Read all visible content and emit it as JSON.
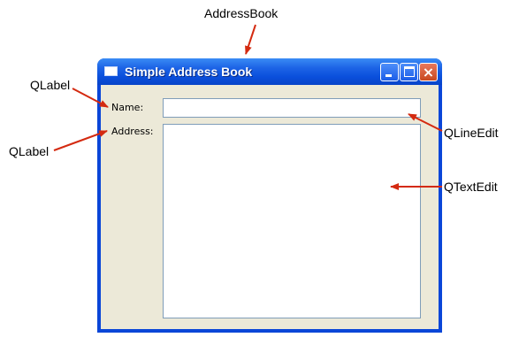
{
  "window": {
    "title": "Simple Address Book",
    "close_glyph": "×"
  },
  "form": {
    "name_label": "Name:",
    "address_label": "Address:",
    "name_value": "",
    "address_value": ""
  },
  "callouts": {
    "window": "AddressBook",
    "name_label": "QLabel",
    "address_label": "QLabel",
    "line_edit": "QLineEdit",
    "text_edit": "QTextEdit"
  },
  "colors": {
    "arrow": "#d42a10",
    "titlebar": "#0a4fdc",
    "client": "#ece9d8"
  },
  "icons": [
    "app-window-icon",
    "minimize-icon",
    "maximize-icon",
    "close-icon",
    "arrow-icon"
  ]
}
